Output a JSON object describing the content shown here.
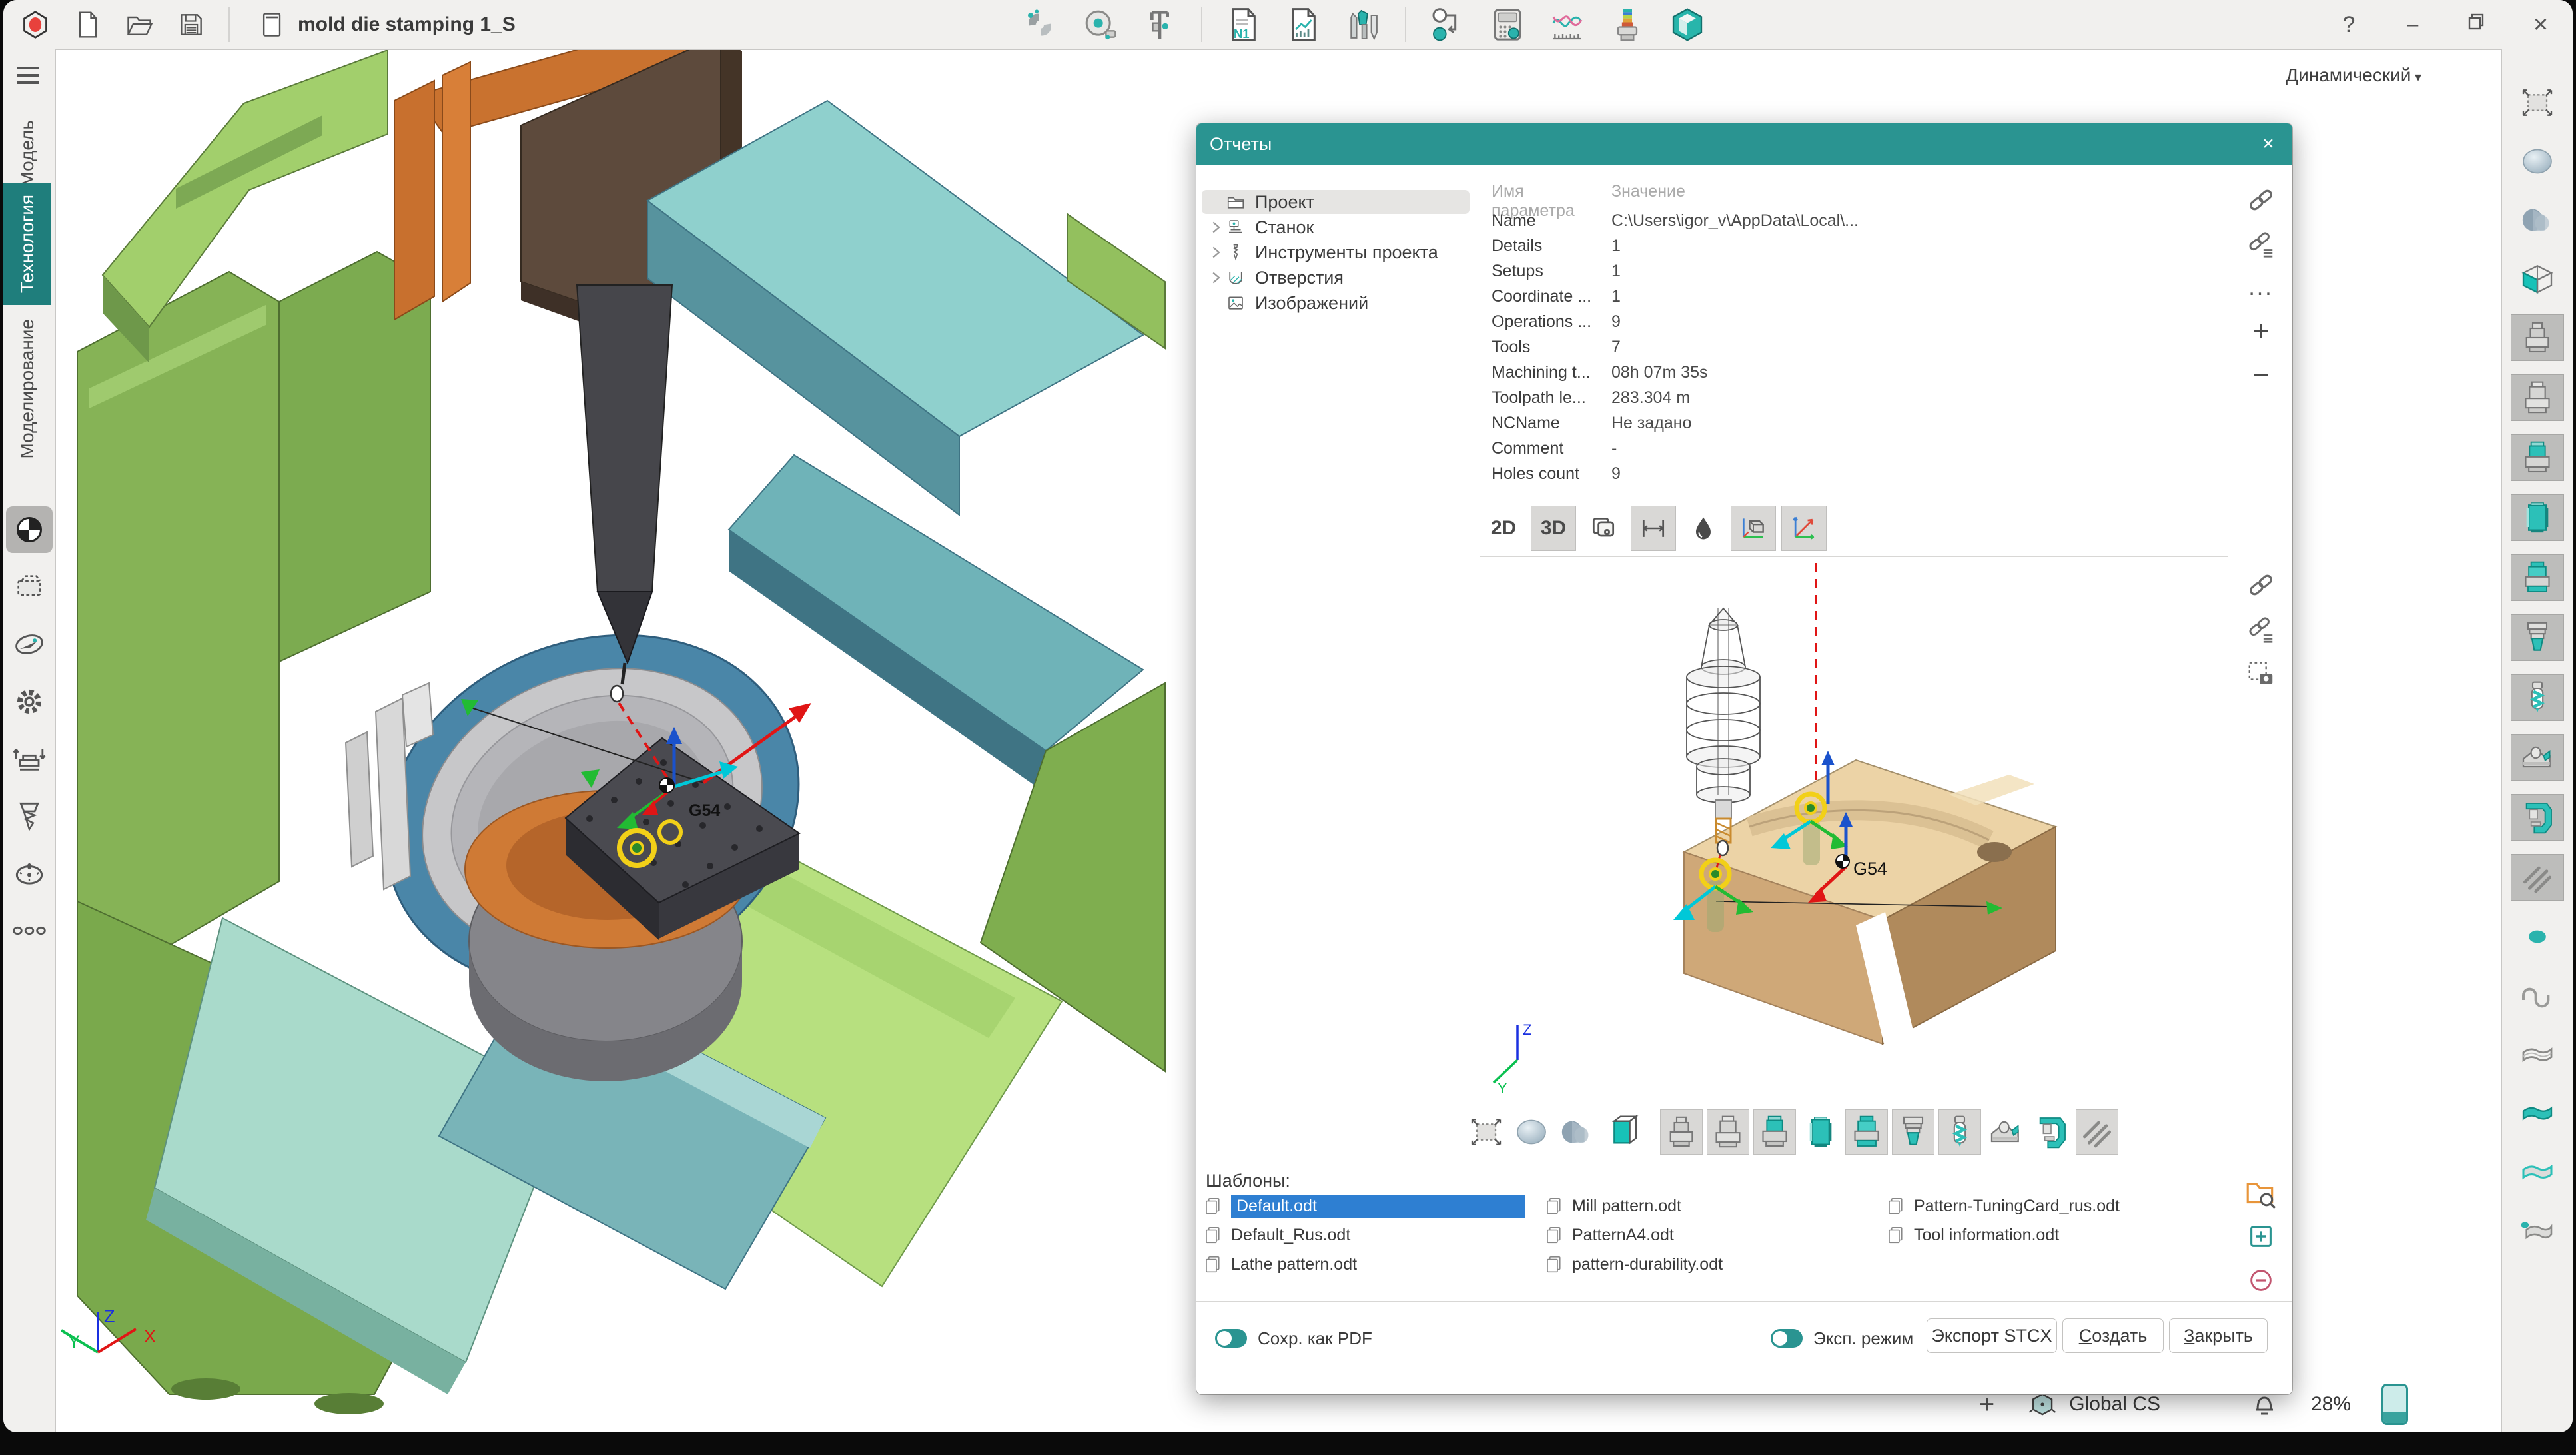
{
  "colors": {
    "accent": "#2a9491",
    "tab_active": "#1f7e7c",
    "selection_blue": "#2e7fd2",
    "viewport_bg": "#ffffff",
    "chrome": "#f1f0ee"
  },
  "titlebar": {
    "left_icons": [
      "app-logo",
      "new-document",
      "open-folder",
      "save"
    ],
    "document_tab": {
      "icon": "document",
      "title": "mold die stamping 1_S"
    },
    "center_icons": [
      "magnet-snap",
      "measure-tape",
      "caliper",
      "nc-program",
      "report-document",
      "tools-library",
      "process-flow",
      "calculator",
      "tool-curves",
      "heat-tool",
      "simulation"
    ],
    "window_controls": {
      "help": "?",
      "minimize": "–",
      "maximize": "maximize",
      "close": "×"
    }
  },
  "sidebar": {
    "tabs": [
      {
        "label": "Модель",
        "active": false
      },
      {
        "label": "Технология",
        "active": true
      },
      {
        "label": "Моделирование",
        "active": false
      }
    ],
    "icons": [
      "workpiece-target",
      "stock-box",
      "compass",
      "gear",
      "machine-table",
      "drill-tool",
      "gauge-clock",
      "more-dots"
    ]
  },
  "viewport": {
    "view_mode": "Динамический",
    "g54": "G54",
    "axes": {
      "x": "X",
      "y": "Y",
      "z": "Z"
    }
  },
  "rsidebar_icons": [
    "fit-selection",
    "sphere-shaded",
    "cone-part",
    "stock-wire-box",
    "holder-gray",
    "holder-silver",
    "holder-collet",
    "cylinder-stock",
    "holder-teal",
    "stepped-tool",
    "drill-bit",
    "machine-fixture",
    "part-fixture",
    "hatch-section",
    "point-dot",
    "curve",
    "surface-wire",
    "surface-teal",
    "surface-half",
    "surface-point"
  ],
  "dialog": {
    "title": "Отчеты",
    "close": "×",
    "tree": {
      "items": [
        {
          "label": "Проект",
          "icon": "project-folder",
          "selected": true,
          "expandable": false
        },
        {
          "label": "Станок",
          "icon": "machine",
          "selected": false,
          "expandable": true
        },
        {
          "label": "Инструменты проекта",
          "icon": "tool",
          "selected": false,
          "expandable": true
        },
        {
          "label": "Отверстия",
          "icon": "hole",
          "selected": false,
          "expandable": true
        },
        {
          "label": "Изображений",
          "icon": "image",
          "selected": false,
          "expandable": false
        }
      ]
    },
    "params": {
      "col_name": "Имя параметра",
      "col_value": "Значение",
      "rows": [
        {
          "label": "Name",
          "value": "C:\\Users\\igor_v\\AppData\\Local\\..."
        },
        {
          "label": "Details",
          "value": "1"
        },
        {
          "label": "Setups",
          "value": "1"
        },
        {
          "label": "Coordinate ...",
          "value": "1"
        },
        {
          "label": "Operations ...",
          "value": "9"
        },
        {
          "label": "Tools",
          "value": "7"
        },
        {
          "label": "Machining t...",
          "value": "08h 07m 35s"
        },
        {
          "label": "Toolpath le...",
          "value": "283.304 m"
        },
        {
          "label": "NCName",
          "value": "Не задано"
        },
        {
          "label": "Comment",
          "value": "-"
        },
        {
          "label": "Holes count",
          "value": "9"
        }
      ],
      "side_icons": [
        "link",
        "link-list",
        "more",
        "add",
        "remove"
      ],
      "more_label": "...",
      "add_label": "+",
      "remove_label": "−"
    },
    "view_tabs": {
      "tab_2d": "2D",
      "tab_3d": "3D",
      "icons": [
        "layers-visibility",
        "dimensions",
        "shading-droplet",
        "cube-axes",
        "axes"
      ]
    },
    "preview": {
      "g54": "G54",
      "axis_z": "Z",
      "axis_y": "Y",
      "side_icons": [
        "link",
        "link-list",
        "screenshot"
      ],
      "bottom_icons": [
        "fit-selection",
        "sphere-shaded",
        "cone-part",
        "stock-teal-box",
        "holder-gray",
        "holder-silver",
        "holder-collet",
        "cylinder-stock",
        "holder-teal",
        "stepped-tool",
        "drill-bit",
        "machine-fixture",
        "part-fixture",
        "hatch-section"
      ]
    },
    "templates": {
      "label": "Шаблоны:",
      "items": [
        "Default.odt",
        "Default_Rus.odt",
        "Lathe pattern.odt",
        "Mill pattern.odt",
        "PatternA4.odt",
        "pattern-durability.odt",
        "Pattern-TuningCard_rus.odt",
        "Tool information.odt"
      ],
      "selected_index": 0,
      "side_icons": [
        "browse-folder",
        "add-template",
        "remove-template"
      ]
    },
    "footer": {
      "toggle_pdf": "Сохр. как PDF",
      "toggle_export": "Эксп. режим",
      "btn_export": "Экспорт STCX",
      "btn_create_key": "С",
      "btn_create_rest": "оздать",
      "btn_close_key": "З",
      "btn_close_rest": "акрыть"
    }
  },
  "statusbar": {
    "add": "+",
    "cs_label": "Global CS",
    "zoom": "28%"
  }
}
